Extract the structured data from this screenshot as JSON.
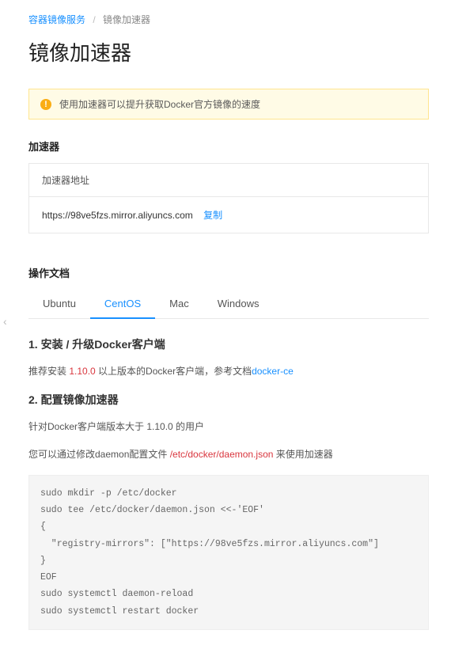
{
  "breadcrumb": {
    "root": "容器镜像服务",
    "current": "镜像加速器"
  },
  "page_title": "镜像加速器",
  "alert": {
    "icon_glyph": "!",
    "text": "使用加速器可以提升获取Docker官方镜像的速度"
  },
  "accelerator": {
    "section_title": "加速器",
    "box_label": "加速器地址",
    "url": "https://98ve5fzs.mirror.aliyuncs.com",
    "copy_label": "复制"
  },
  "docs": {
    "section_title": "操作文档",
    "tabs": [
      {
        "label": "Ubuntu",
        "active": false
      },
      {
        "label": "CentOS",
        "active": true
      },
      {
        "label": "Mac",
        "active": false
      },
      {
        "label": "Windows",
        "active": false
      }
    ],
    "step1": {
      "heading": "1. 安装 / 升级Docker客户端",
      "prefix": "推荐安装 ",
      "highlight": "1.10.0",
      "suffix": " 以上版本的Docker客户端，参考文档",
      "link": "docker-ce"
    },
    "step2": {
      "heading": "2. 配置镜像加速器",
      "line1": "针对Docker客户端版本大于 1.10.0 的用户",
      "line2_prefix": "您可以通过修改daemon配置文件 ",
      "line2_highlight": "/etc/docker/daemon.json",
      "line2_suffix": " 来使用加速器",
      "code": "sudo mkdir -p /etc/docker\nsudo tee /etc/docker/daemon.json <<-'EOF'\n{\n  \"registry-mirrors\": [\"https://98ve5fzs.mirror.aliyuncs.com\"]\n}\nEOF\nsudo systemctl daemon-reload\nsudo systemctl restart docker"
    }
  },
  "left_toggle_glyph": "‹"
}
